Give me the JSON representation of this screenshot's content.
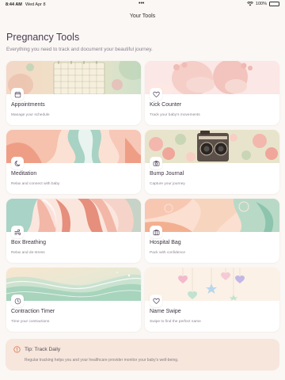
{
  "status_bar": {
    "time": "8:44 AM",
    "date": "Wed Apr 8",
    "dots": "•••",
    "battery": "100%",
    "battery_level": 1.0
  },
  "nav": {
    "title": "Your Tools"
  },
  "header": {
    "title": "Pregnancy Tools",
    "subtitle": "Everything you need to track and document your beautiful journey."
  },
  "tools": [
    {
      "title": "Appointments",
      "description": "Manage your schedule",
      "icon": "calendar-icon"
    },
    {
      "title": "Kick Counter",
      "description": "Track your baby's movements",
      "icon": "heart-icon"
    },
    {
      "title": "Meditation",
      "description": "Relax and connect with baby",
      "icon": "moon-icon"
    },
    {
      "title": "Bump Journal",
      "description": "Capture your journey",
      "icon": "camera-icon"
    },
    {
      "title": "Box Breathing",
      "description": "Relax and de-stress",
      "icon": "wind-icon"
    },
    {
      "title": "Hospital Bag",
      "description": "Pack with confidence",
      "icon": "bag-icon"
    },
    {
      "title": "Contraction Timer",
      "description": "Time your contractions",
      "icon": "clock-icon"
    },
    {
      "title": "Name Swipe",
      "description": "Swipe to find the perfect name",
      "icon": "heart-icon"
    }
  ],
  "tip": {
    "title": "Tip: Track Daily",
    "body": "Regular tracking helps you and your healthcare provider monitor your baby's well-being.",
    "icon": "info-icon"
  },
  "colors": {
    "accent": "#4b3a53",
    "tip_background": "#f6e6dc",
    "tip_icon": "#d9714e",
    "background": "#faf7f4"
  }
}
